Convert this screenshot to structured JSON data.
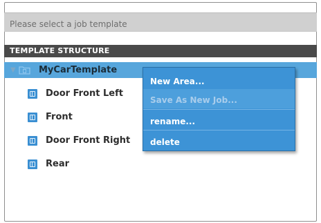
{
  "job_selector": {
    "placeholder": "Please select a job template"
  },
  "template_structure": {
    "header": "TEMPLATE STRUCTURE",
    "root": {
      "label": "MyCarTemplate",
      "expanded": true,
      "icon": "folder-icon"
    },
    "items": [
      {
        "label": "Door Front Left",
        "icon": "area-icon"
      },
      {
        "label": "Front",
        "icon": "area-icon"
      },
      {
        "label": "Door Front Right",
        "icon": "area-icon"
      },
      {
        "label": "Rear",
        "icon": "area-icon"
      }
    ]
  },
  "context_menu": {
    "items": [
      {
        "label": "New Area...",
        "enabled": true
      },
      {
        "label": "Save As New Job...",
        "enabled": false
      },
      {
        "label": "rename...",
        "enabled": true
      },
      {
        "label": "delete",
        "enabled": true
      }
    ]
  },
  "colors": {
    "selection": "#57a6dc",
    "menu_background": "#3d93d6",
    "header_background": "#4a4a4a",
    "item_icon": "#3a8fd2"
  }
}
